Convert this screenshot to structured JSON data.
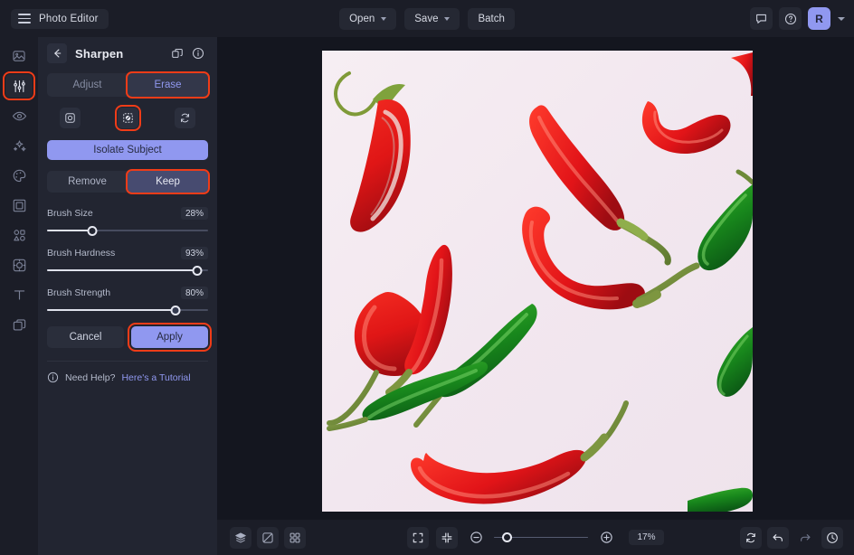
{
  "app": {
    "title": "Photo Editor",
    "accent": "#9098f0",
    "highlight": "#f03c18",
    "panel_bg": "#222531",
    "canvas_bg": "#14161f"
  },
  "topbar": {
    "menu_label": "Photo Editor",
    "buttons": [
      {
        "label": "Open",
        "has_caret": true,
        "name": "open-button"
      },
      {
        "label": "Save",
        "has_caret": true,
        "name": "save-button"
      },
      {
        "label": "Batch",
        "has_caret": false,
        "name": "batch-button"
      }
    ],
    "right": {
      "feedback_icon": "chat-bubble-icon",
      "help_icon": "question-circle-icon",
      "avatar_initial": "R",
      "avatar_caret_icon": "chevron-down-icon"
    }
  },
  "sidebar": {
    "items": [
      {
        "icon": "image-icon",
        "name": "sidebar-item-image",
        "active": false,
        "highlighted": false
      },
      {
        "icon": "adjust-sliders-icon",
        "name": "sidebar-item-adjust",
        "active": true,
        "highlighted": true
      },
      {
        "icon": "eye-retouch-icon",
        "name": "sidebar-item-retouch",
        "active": false,
        "highlighted": false
      },
      {
        "icon": "sparkles-effects-icon",
        "name": "sidebar-item-effects",
        "active": false,
        "highlighted": false
      },
      {
        "icon": "palette-icon",
        "name": "sidebar-item-color",
        "active": false,
        "highlighted": false
      },
      {
        "icon": "frame-icon",
        "name": "sidebar-item-frames",
        "active": false,
        "highlighted": false
      },
      {
        "icon": "shapes-icon",
        "name": "sidebar-item-shapes",
        "active": false,
        "highlighted": false
      },
      {
        "icon": "overlay-icon",
        "name": "sidebar-item-overlays",
        "active": false,
        "highlighted": false
      },
      {
        "icon": "text-icon",
        "name": "sidebar-item-text",
        "active": false,
        "highlighted": false
      },
      {
        "icon": "layers-icon",
        "name": "sidebar-item-layers",
        "active": false,
        "highlighted": false
      }
    ]
  },
  "panel": {
    "back_icon": "arrow-left-icon",
    "title": "Sharpen",
    "copy_icon": "duplicate-icon",
    "info_icon": "info-circle-icon",
    "tabs": [
      {
        "label": "Adjust",
        "active": false,
        "highlighted": false,
        "name": "tab-adjust"
      },
      {
        "label": "Erase",
        "active": true,
        "highlighted": true,
        "name": "tab-erase"
      }
    ],
    "tools": [
      {
        "icon": "selection-target-icon",
        "name": "tool-select",
        "highlighted": false
      },
      {
        "icon": "invert-brush-icon",
        "name": "tool-brush",
        "highlighted": true
      },
      {
        "icon": "refresh-invert-icon",
        "name": "tool-reset-selection",
        "highlighted": false
      }
    ],
    "isolate_label": "Isolate Subject",
    "mode": [
      {
        "label": "Remove",
        "active": false,
        "highlighted": false,
        "name": "mode-remove"
      },
      {
        "label": "Keep",
        "active": true,
        "highlighted": true,
        "name": "mode-keep"
      }
    ],
    "sliders": [
      {
        "label": "Brush Size",
        "value": "28%",
        "percent": 28,
        "name": "brush-size-slider"
      },
      {
        "label": "Brush Hardness",
        "value": "93%",
        "percent": 93,
        "name": "brush-hardness-slider"
      },
      {
        "label": "Brush Strength",
        "value": "80%",
        "percent": 80,
        "name": "brush-strength-slider"
      }
    ],
    "cancel_label": "Cancel",
    "apply_label": "Apply",
    "help": {
      "icon": "info-circle-icon",
      "text": "Need Help? ",
      "link": "Here's a Tutorial"
    }
  },
  "bottombar": {
    "left": [
      {
        "icon": "layers-stack-icon",
        "name": "layers-button"
      },
      {
        "icon": "compare-icon",
        "name": "compare-button"
      },
      {
        "icon": "grid-icon",
        "name": "grid-button"
      }
    ],
    "center": {
      "fit_icon": "fit-screen-icon",
      "actual_icon": "collapse-icon",
      "zoom_out_icon": "zoom-out-icon",
      "zoom_in_icon": "zoom-in-icon",
      "zoom_value": "17%",
      "zoom_percent": 8
    },
    "right": [
      {
        "icon": "reset-icon",
        "name": "reset-button"
      },
      {
        "icon": "undo-icon",
        "name": "undo-button"
      },
      {
        "icon": "redo-icon",
        "name": "redo-button"
      },
      {
        "icon": "history-icon",
        "name": "history-button"
      }
    ]
  },
  "canvas": {
    "image_description": "Red and green chili peppers on a pale pink background",
    "background": "#f3e9f0"
  }
}
